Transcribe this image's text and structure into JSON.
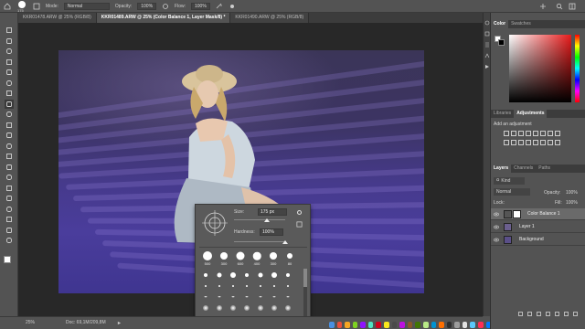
{
  "options_bar": {
    "brush_size": "175",
    "mode_label": "Mode:",
    "mode_value": "Normal",
    "opacity_label": "Opacity:",
    "opacity_value": "100%",
    "flow_label": "Flow:",
    "flow_value": "100%"
  },
  "tabs": [
    {
      "label": "KKR01478.ARW @ 25% (RGB/8)",
      "active": false
    },
    {
      "label": "KKR01489.ARW @ 25% (Color Balance 1, Layer Mask/8) *",
      "active": true
    },
    {
      "label": "KKR01490.ARW @ 25% (RGB/8)",
      "active": false
    }
  ],
  "toolbar": {
    "icons": [
      "move-icon",
      "marquee-icon",
      "lasso-icon",
      "quick-select-icon",
      "crop-icon",
      "eyedropper-icon",
      "healing-icon",
      "brush-icon",
      "clone-stamp-icon",
      "history-brush-icon",
      "eraser-icon",
      "gradient-icon",
      "blur-icon",
      "dodge-icon",
      "pen-icon",
      "type-icon",
      "path-select-icon",
      "shape-icon",
      "hand-icon",
      "zoom-icon",
      "more-icon"
    ]
  },
  "brush_picker": {
    "size_label": "Size:",
    "size_value": "175 px",
    "hardness_label": "Hardness:",
    "hardness_value": "100%",
    "size_fraction": 0.65,
    "hardness_fraction": 1.0,
    "presets": [
      "500",
      "300",
      "600",
      "400",
      "300",
      "80"
    ],
    "swatch_labels": [
      "25",
      "50"
    ]
  },
  "status_bar": {
    "zoom": "25%",
    "doc": "Doc: 69,1M/209,8M"
  },
  "color_panel": {
    "tabs": [
      {
        "label": "Color",
        "active": true
      },
      {
        "label": "Swatches",
        "active": false
      }
    ],
    "foreground": "#ffffff",
    "background": "#000000"
  },
  "adjustments_panel": {
    "tabs": [
      {
        "label": "Libraries",
        "active": false
      },
      {
        "label": "Adjustments",
        "active": true
      }
    ],
    "heading": "Add an adjustment"
  },
  "layers_panel": {
    "tabs": [
      {
        "label": "Layers",
        "active": true
      },
      {
        "label": "Channels",
        "active": false
      },
      {
        "label": "Paths",
        "active": false
      }
    ],
    "kind_label": "Kind",
    "blend_mode": "Normal",
    "opacity_label": "Opacity:",
    "opacity_value": "100%",
    "lock_label": "Lock:",
    "fill_label": "Fill:",
    "fill_value": "100%",
    "layers": [
      {
        "name": "Color Balance 1",
        "selected": true
      },
      {
        "name": "Layer 1",
        "selected": false
      },
      {
        "name": "Background",
        "selected": false
      }
    ]
  },
  "colors": {
    "ui_bg": "#535353",
    "canvas_bg": "#282828",
    "lavender": "#4a3d9c"
  }
}
